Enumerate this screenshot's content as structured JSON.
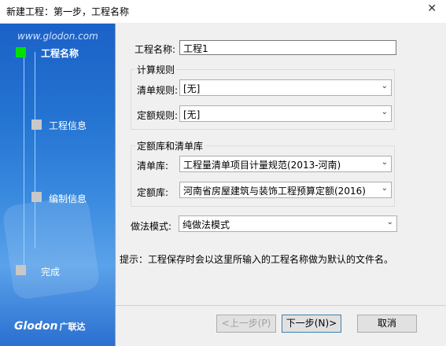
{
  "window": {
    "title": "新建工程：第一步，工程名称",
    "close_glyph": "✕"
  },
  "sidebar": {
    "site": "www.glodon.com",
    "steps": [
      {
        "label": "工程名称",
        "active": true
      },
      {
        "label": "工程信息",
        "active": false
      },
      {
        "label": "编制信息",
        "active": false
      },
      {
        "label": "完成",
        "active": false
      }
    ],
    "logo": "Glodon",
    "logo_cn": "广联达"
  },
  "form": {
    "project_name_label": "工程名称:",
    "project_name_value": "工程1",
    "calc_rules_group": "计算规则",
    "bill_rule_label": "清单规则:",
    "bill_rule_value": "[无]",
    "quota_rule_label": "定额规则:",
    "quota_rule_value": "[无]",
    "library_group": "定额库和清单库",
    "bill_lib_label": "清单库:",
    "bill_lib_value": "工程量清单项目计量规范(2013-河南)",
    "quota_lib_label": "定额库:",
    "quota_lib_value": "河南省房屋建筑与装饰工程预算定额(2016)",
    "method_label": "做法模式:",
    "method_value": "纯做法模式",
    "hint": "提示：工程保存时会以这里所输入的工程名称做为默认的文件名。"
  },
  "buttons": {
    "prev": "<上一步(P)",
    "next": "下一步(N)>",
    "cancel": "取消"
  },
  "colors": {
    "active_step": "#00e000",
    "sidebar": "#2474d2"
  }
}
